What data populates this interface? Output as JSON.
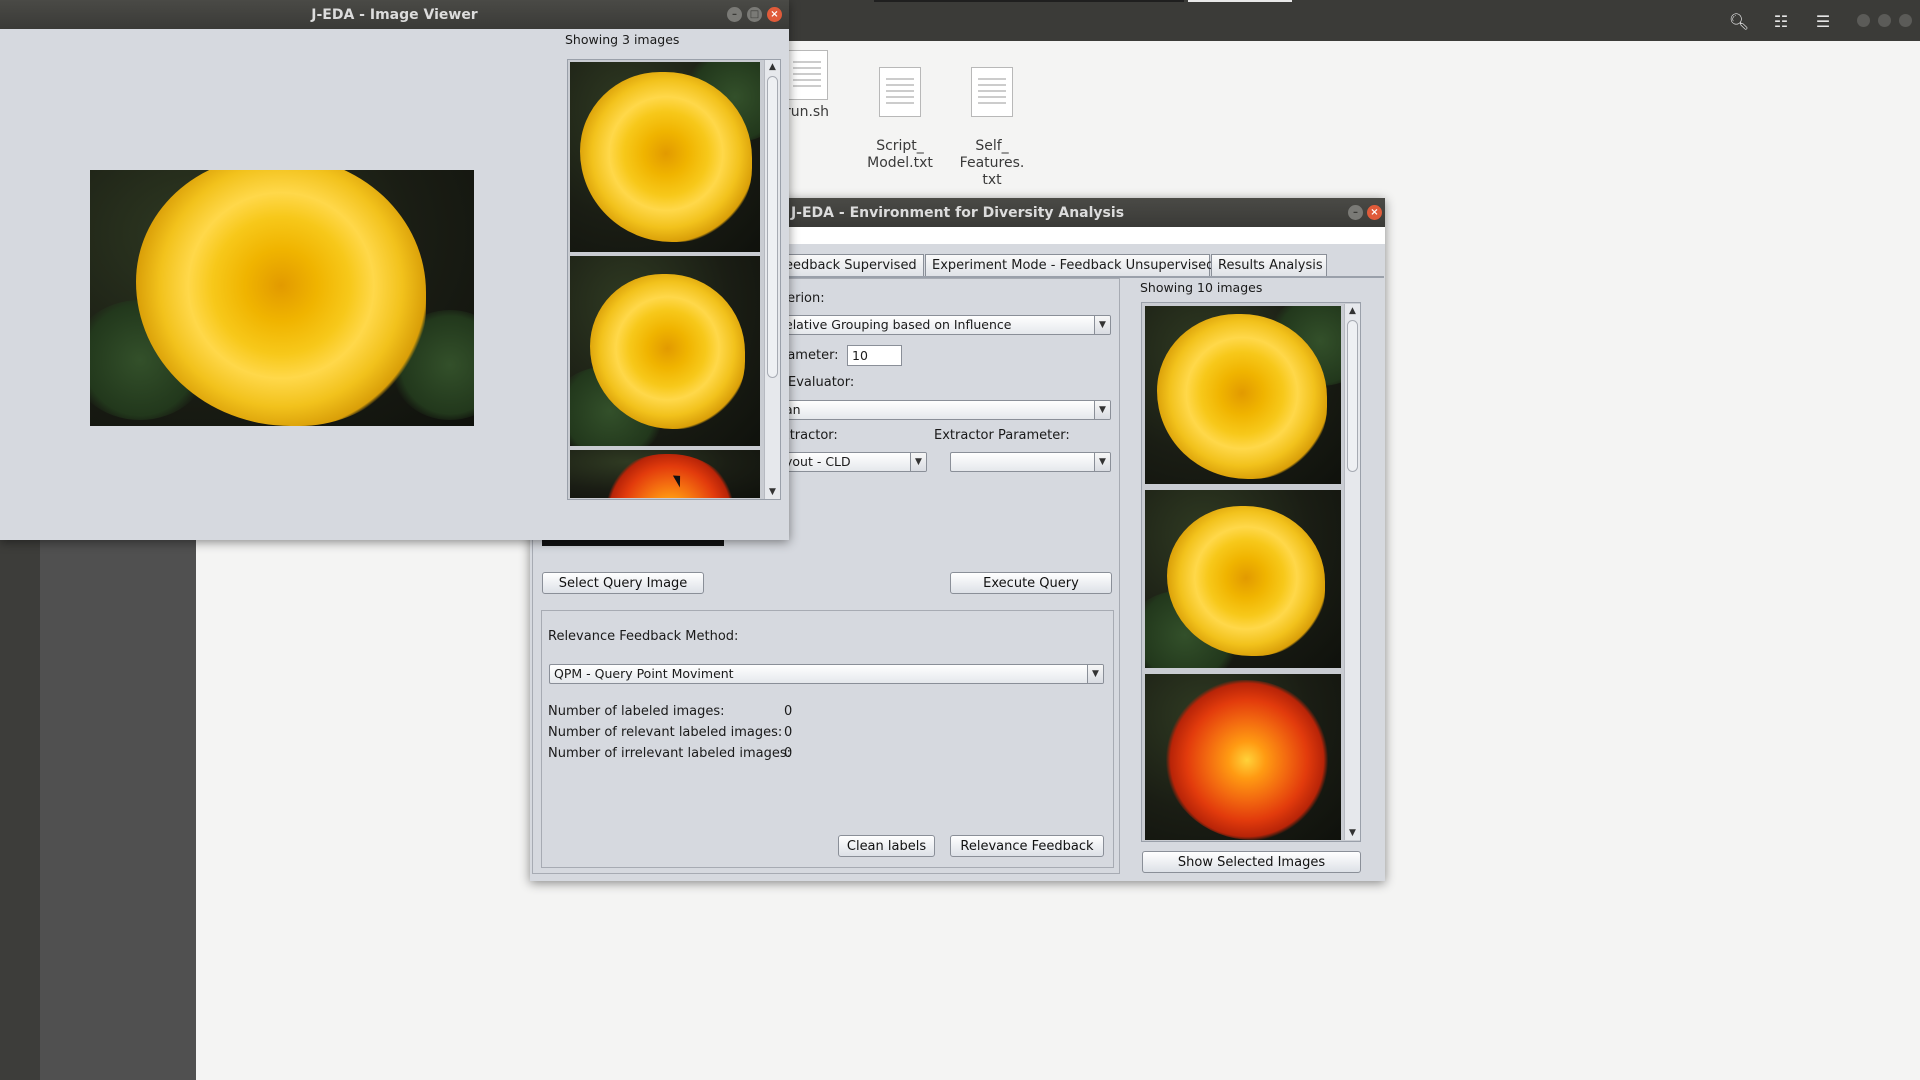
{
  "desktop": {
    "files": [
      {
        "name": "run.sh"
      },
      {
        "name": "Script_\nModel.txt"
      },
      {
        "name": "Self_\nFeatures.\ntxt"
      }
    ]
  },
  "image_viewer": {
    "title": "J-EDA - Image Viewer",
    "showing_label": "Showing 3 images"
  },
  "main_window": {
    "title": "J-EDA - Environment for Diversity Analysis",
    "tabs": [
      {
        "label": "eedback Supervised"
      },
      {
        "label": "Experiment Mode - Feedback Unsupervised"
      },
      {
        "label": "Results Analysis"
      }
    ],
    "criterion_label": "terion:",
    "criterion_value": "elative Grouping based on Influence",
    "parameter_label": "rameter:",
    "parameter_value": "10",
    "evaluator_label": "Evaluator:",
    "evaluator_value": "an",
    "extractor_label": "xtractor:",
    "extractor_value": "yout - CLD",
    "extractor_param_label": "Extractor Parameter:",
    "extractor_param_value": "",
    "select_query_button": "Select Query Image",
    "execute_query_button": "Execute Query",
    "relevance_method_label": "Relevance Feedback Method:",
    "relevance_method_value": "QPM - Query Point Moviment",
    "stats": [
      {
        "label": "Number of labeled images:",
        "value": "0"
      },
      {
        "label": "Number of relevant labeled images:",
        "value": "0"
      },
      {
        "label": "Number of irrelevant labeled images:",
        "value": "0"
      }
    ],
    "clean_labels_button": "Clean labels",
    "relevance_feedback_button": "Relevance Feedback",
    "results_showing_label": "Showing 10 images",
    "show_selected_button": "Show Selected Images"
  },
  "colors": {
    "window_bg": "#d6d9df",
    "titlebar": "#3b3b38",
    "close_button": "#e05b3a"
  }
}
